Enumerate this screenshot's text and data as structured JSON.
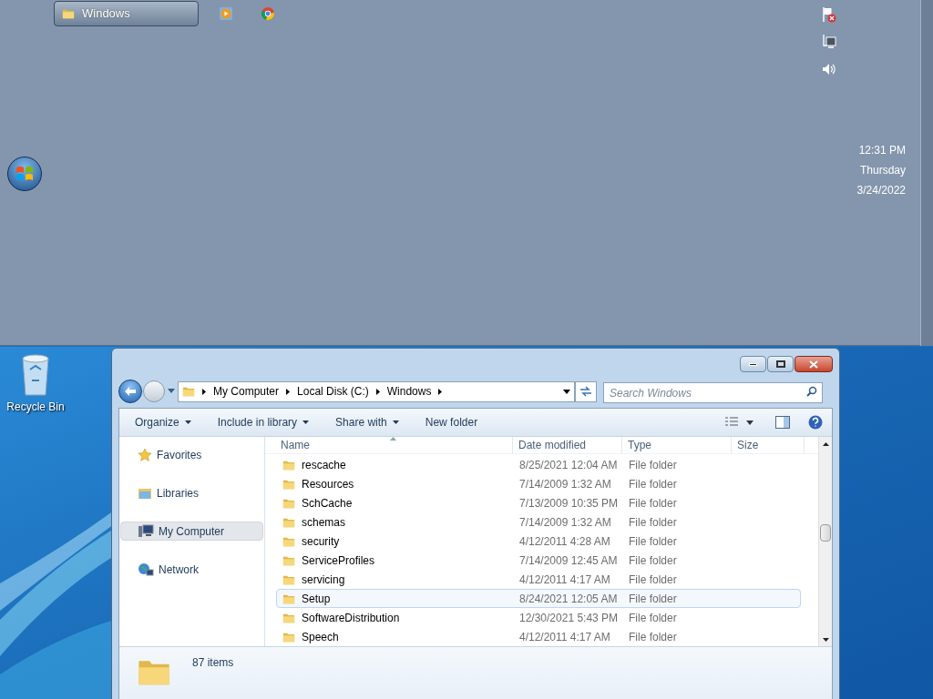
{
  "taskbar": {
    "buttons": [
      {
        "kind": "folder",
        "label": "Windows",
        "selected": true
      },
      {
        "kind": "media",
        "selected": false
      },
      {
        "kind": "browser",
        "selected": false
      }
    ],
    "tray": [
      {
        "kind": "flag"
      },
      {
        "kind": "network"
      },
      {
        "kind": "volume"
      }
    ],
    "clock": {
      "time": "12:31 PM",
      "day": "Thursday",
      "date": "3/24/2022"
    }
  },
  "desktop": {
    "icons": [
      {
        "label": "Recycle Bin"
      }
    ]
  },
  "window": {
    "address": [
      "My Computer",
      "Local Disk (C:)",
      "Windows"
    ],
    "search": {
      "placeholder": "Search Windows"
    },
    "toolbar": [
      {
        "label": "Organize",
        "dropdown": true
      },
      {
        "label": "Include in library",
        "dropdown": true
      },
      {
        "label": "Share with",
        "dropdown": true
      },
      {
        "label": "New folder",
        "dropdown": false
      }
    ],
    "nav": [
      {
        "kind": "favorites",
        "label": "Favorites",
        "selected": false
      },
      {
        "kind": "libraries",
        "label": "Libraries",
        "selected": false
      },
      {
        "kind": "computer",
        "label": "My Computer",
        "selected": true
      },
      {
        "kind": "network",
        "label": "Network",
        "selected": false
      }
    ],
    "columns": [
      "Name",
      "Date modified",
      "Type",
      "Size"
    ],
    "rows": [
      {
        "name": "rescache",
        "date": "8/25/2021 12:04 AM",
        "type": "File folder",
        "selected": false
      },
      {
        "name": "Resources",
        "date": "7/14/2009 1:32 AM",
        "type": "File folder",
        "selected": false
      },
      {
        "name": "SchCache",
        "date": "7/13/2009 10:35 PM",
        "type": "File folder",
        "selected": false
      },
      {
        "name": "schemas",
        "date": "7/14/2009 1:32 AM",
        "type": "File folder",
        "selected": false
      },
      {
        "name": "security",
        "date": "4/12/2011 4:28 AM",
        "type": "File folder",
        "selected": false
      },
      {
        "name": "ServiceProfiles",
        "date": "7/14/2009 12:45 AM",
        "type": "File folder",
        "selected": false
      },
      {
        "name": "servicing",
        "date": "4/12/2011 4:17 AM",
        "type": "File folder",
        "selected": false
      },
      {
        "name": "Setup",
        "date": "8/24/2021 12:05 AM",
        "type": "File folder",
        "selected": true
      },
      {
        "name": "SoftwareDistribution",
        "date": "12/30/2021 5:43 PM",
        "type": "File folder",
        "selected": false
      },
      {
        "name": "Speech",
        "date": "4/12/2011 4:17 AM",
        "type": "File folder",
        "selected": false
      }
    ],
    "status": {
      "count": "87 items"
    }
  }
}
